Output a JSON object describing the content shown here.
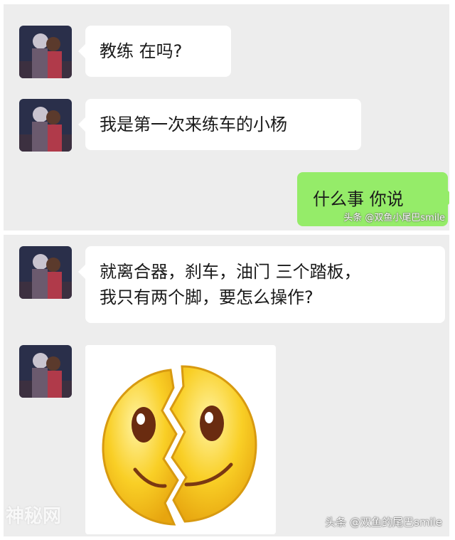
{
  "chat": {
    "panel_top": {
      "messages": [
        {
          "sender": "coach_contact",
          "text": "教练 在吗?"
        },
        {
          "sender": "coach_contact",
          "text": "我是第一次来练车的小杨"
        },
        {
          "sender": "me",
          "text": "什么事 你说"
        }
      ],
      "watermark": "头条 @双鱼小尾巴smile"
    },
    "panel_bottom": {
      "messages": [
        {
          "sender": "coach_contact",
          "line1": "就离合器，刹车，油门 三个踏板，",
          "line2": "我只有两个脚，要怎么操作?"
        },
        {
          "sender": "coach_contact",
          "sticker": "broken-heart-smiley-face-sticker"
        }
      ],
      "watermark": "头条 @双鱼的尾巴smile"
    }
  },
  "site_watermark": "神秘网",
  "colors": {
    "panel_bg": "#ededed",
    "incoming_bubble": "#ffffff",
    "outgoing_bubble": "#95ec69",
    "sticker_face": "#f7c51a"
  }
}
